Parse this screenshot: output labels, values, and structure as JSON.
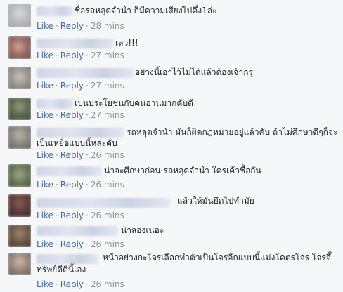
{
  "labels": {
    "like": "Like",
    "reply": "Reply",
    "sep": "·"
  },
  "comments": [
    {
      "text": "ชื่อรถหลุดจำนำ ก็มีความเสียงไปคึ่ง1ล่ะ",
      "time": "28 mins"
    },
    {
      "text": "เลว!!!",
      "time": "27 mins"
    },
    {
      "text": "อย่างนี้เอาไว้ไม่ได้แล้วต้องเจ้ากรุ",
      "time": "27 mins"
    },
    {
      "text": "เปนประโยชนกับคนอ่านมากคับดี",
      "time": "27 mins"
    },
    {
      "text": "รถหลุดจำนำ มันก็ผิดกฎหมายอยู่แล้วคับ ถ้าไม่ศึกษาดีๆก็จะ",
      "text2": "เป็นเหยื่อแบบนี้หละคับ",
      "time": "26 mins"
    },
    {
      "text": "น่าจะศึกษาก่อน รถหลุดจำนำ ใครเค้าซื้อกัน",
      "time": "26 mins"
    },
    {
      "text": "แล้วให้มันยึดไปทำมัย",
      "time": "26 mins"
    },
    {
      "text": "น่าลองเนอะ",
      "time": "26 mins"
    },
    {
      "text": "หน้าอย่างกะโจรเลือกทำตัวเป็นโจรอีกแบบนี้แม่งโคตรโจร โจรจึ๊",
      "text2": "ทรัพย์ดีดีนี้เอง",
      "time": "26 mins"
    }
  ]
}
